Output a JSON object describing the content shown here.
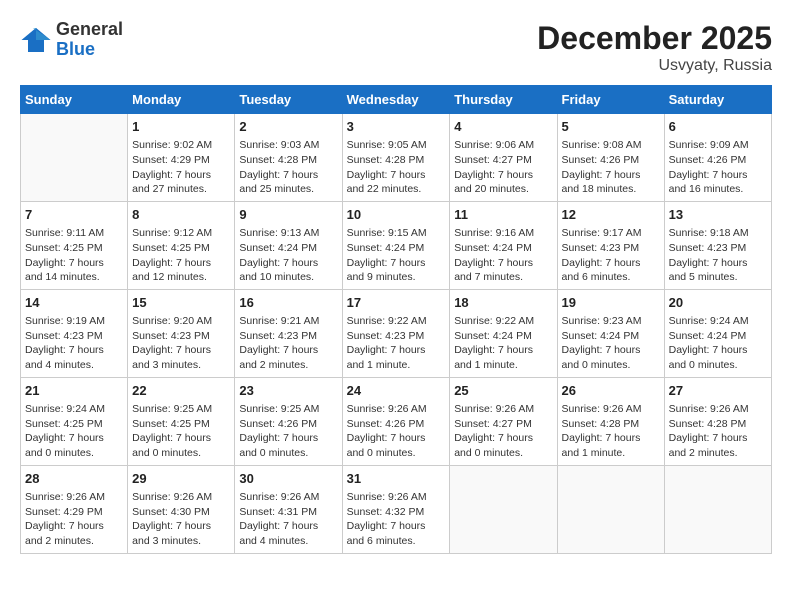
{
  "header": {
    "logo_general": "General",
    "logo_blue": "Blue",
    "month_title": "December 2025",
    "location": "Usvyaty, Russia"
  },
  "calendar": {
    "days_of_week": [
      "Sunday",
      "Monday",
      "Tuesday",
      "Wednesday",
      "Thursday",
      "Friday",
      "Saturday"
    ],
    "weeks": [
      [
        {
          "day": "",
          "info": ""
        },
        {
          "day": "1",
          "info": "Sunrise: 9:02 AM\nSunset: 4:29 PM\nDaylight: 7 hours\nand 27 minutes."
        },
        {
          "day": "2",
          "info": "Sunrise: 9:03 AM\nSunset: 4:28 PM\nDaylight: 7 hours\nand 25 minutes."
        },
        {
          "day": "3",
          "info": "Sunrise: 9:05 AM\nSunset: 4:28 PM\nDaylight: 7 hours\nand 22 minutes."
        },
        {
          "day": "4",
          "info": "Sunrise: 9:06 AM\nSunset: 4:27 PM\nDaylight: 7 hours\nand 20 minutes."
        },
        {
          "day": "5",
          "info": "Sunrise: 9:08 AM\nSunset: 4:26 PM\nDaylight: 7 hours\nand 18 minutes."
        },
        {
          "day": "6",
          "info": "Sunrise: 9:09 AM\nSunset: 4:26 PM\nDaylight: 7 hours\nand 16 minutes."
        }
      ],
      [
        {
          "day": "7",
          "info": "Sunrise: 9:11 AM\nSunset: 4:25 PM\nDaylight: 7 hours\nand 14 minutes."
        },
        {
          "day": "8",
          "info": "Sunrise: 9:12 AM\nSunset: 4:25 PM\nDaylight: 7 hours\nand 12 minutes."
        },
        {
          "day": "9",
          "info": "Sunrise: 9:13 AM\nSunset: 4:24 PM\nDaylight: 7 hours\nand 10 minutes."
        },
        {
          "day": "10",
          "info": "Sunrise: 9:15 AM\nSunset: 4:24 PM\nDaylight: 7 hours\nand 9 minutes."
        },
        {
          "day": "11",
          "info": "Sunrise: 9:16 AM\nSunset: 4:24 PM\nDaylight: 7 hours\nand 7 minutes."
        },
        {
          "day": "12",
          "info": "Sunrise: 9:17 AM\nSunset: 4:23 PM\nDaylight: 7 hours\nand 6 minutes."
        },
        {
          "day": "13",
          "info": "Sunrise: 9:18 AM\nSunset: 4:23 PM\nDaylight: 7 hours\nand 5 minutes."
        }
      ],
      [
        {
          "day": "14",
          "info": "Sunrise: 9:19 AM\nSunset: 4:23 PM\nDaylight: 7 hours\nand 4 minutes."
        },
        {
          "day": "15",
          "info": "Sunrise: 9:20 AM\nSunset: 4:23 PM\nDaylight: 7 hours\nand 3 minutes."
        },
        {
          "day": "16",
          "info": "Sunrise: 9:21 AM\nSunset: 4:23 PM\nDaylight: 7 hours\nand 2 minutes."
        },
        {
          "day": "17",
          "info": "Sunrise: 9:22 AM\nSunset: 4:23 PM\nDaylight: 7 hours\nand 1 minute."
        },
        {
          "day": "18",
          "info": "Sunrise: 9:22 AM\nSunset: 4:24 PM\nDaylight: 7 hours\nand 1 minute."
        },
        {
          "day": "19",
          "info": "Sunrise: 9:23 AM\nSunset: 4:24 PM\nDaylight: 7 hours\nand 0 minutes."
        },
        {
          "day": "20",
          "info": "Sunrise: 9:24 AM\nSunset: 4:24 PM\nDaylight: 7 hours\nand 0 minutes."
        }
      ],
      [
        {
          "day": "21",
          "info": "Sunrise: 9:24 AM\nSunset: 4:25 PM\nDaylight: 7 hours\nand 0 minutes."
        },
        {
          "day": "22",
          "info": "Sunrise: 9:25 AM\nSunset: 4:25 PM\nDaylight: 7 hours\nand 0 minutes."
        },
        {
          "day": "23",
          "info": "Sunrise: 9:25 AM\nSunset: 4:26 PM\nDaylight: 7 hours\nand 0 minutes."
        },
        {
          "day": "24",
          "info": "Sunrise: 9:26 AM\nSunset: 4:26 PM\nDaylight: 7 hours\nand 0 minutes."
        },
        {
          "day": "25",
          "info": "Sunrise: 9:26 AM\nSunset: 4:27 PM\nDaylight: 7 hours\nand 0 minutes."
        },
        {
          "day": "26",
          "info": "Sunrise: 9:26 AM\nSunset: 4:28 PM\nDaylight: 7 hours\nand 1 minute."
        },
        {
          "day": "27",
          "info": "Sunrise: 9:26 AM\nSunset: 4:28 PM\nDaylight: 7 hours\nand 2 minutes."
        }
      ],
      [
        {
          "day": "28",
          "info": "Sunrise: 9:26 AM\nSunset: 4:29 PM\nDaylight: 7 hours\nand 2 minutes."
        },
        {
          "day": "29",
          "info": "Sunrise: 9:26 AM\nSunset: 4:30 PM\nDaylight: 7 hours\nand 3 minutes."
        },
        {
          "day": "30",
          "info": "Sunrise: 9:26 AM\nSunset: 4:31 PM\nDaylight: 7 hours\nand 4 minutes."
        },
        {
          "day": "31",
          "info": "Sunrise: 9:26 AM\nSunset: 4:32 PM\nDaylight: 7 hours\nand 6 minutes."
        },
        {
          "day": "",
          "info": ""
        },
        {
          "day": "",
          "info": ""
        },
        {
          "day": "",
          "info": ""
        }
      ]
    ]
  }
}
